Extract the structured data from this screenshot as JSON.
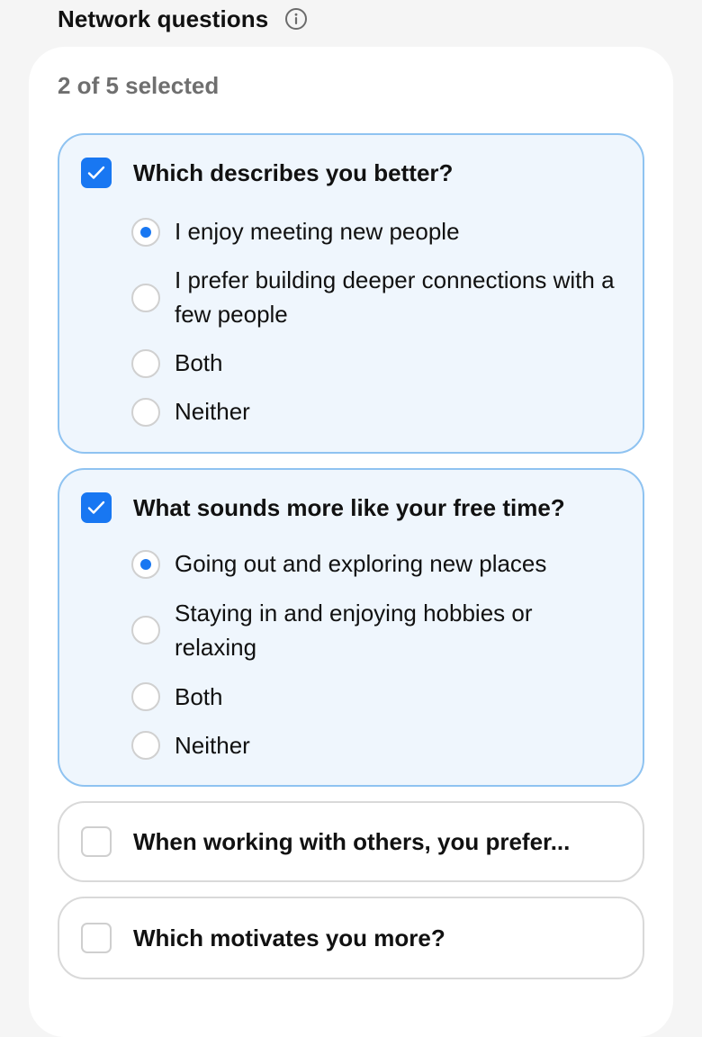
{
  "header": {
    "title": "Network questions",
    "info_icon": "info-circle-icon"
  },
  "selection_count": "2 of 5 selected",
  "colors": {
    "accent": "#1877f2",
    "selected_bg": "#eff6fd",
    "selected_border": "#8fc3f1"
  },
  "questions": [
    {
      "text": "Which describes you better?",
      "checked": true,
      "options": [
        {
          "label": "I enjoy meeting new people",
          "selected": true
        },
        {
          "label": "I prefer building deeper connections with a few people",
          "selected": false
        },
        {
          "label": "Both",
          "selected": false
        },
        {
          "label": "Neither",
          "selected": false
        }
      ]
    },
    {
      "text": "What sounds more like your free time?",
      "checked": true,
      "options": [
        {
          "label": "Going out and exploring new places",
          "selected": true
        },
        {
          "label": "Staying in and enjoying hobbies or relaxing",
          "selected": false
        },
        {
          "label": "Both",
          "selected": false
        },
        {
          "label": "Neither",
          "selected": false
        }
      ]
    },
    {
      "text": "When working with others, you prefer...",
      "checked": false
    },
    {
      "text": "Which motivates you more?",
      "checked": false
    }
  ]
}
